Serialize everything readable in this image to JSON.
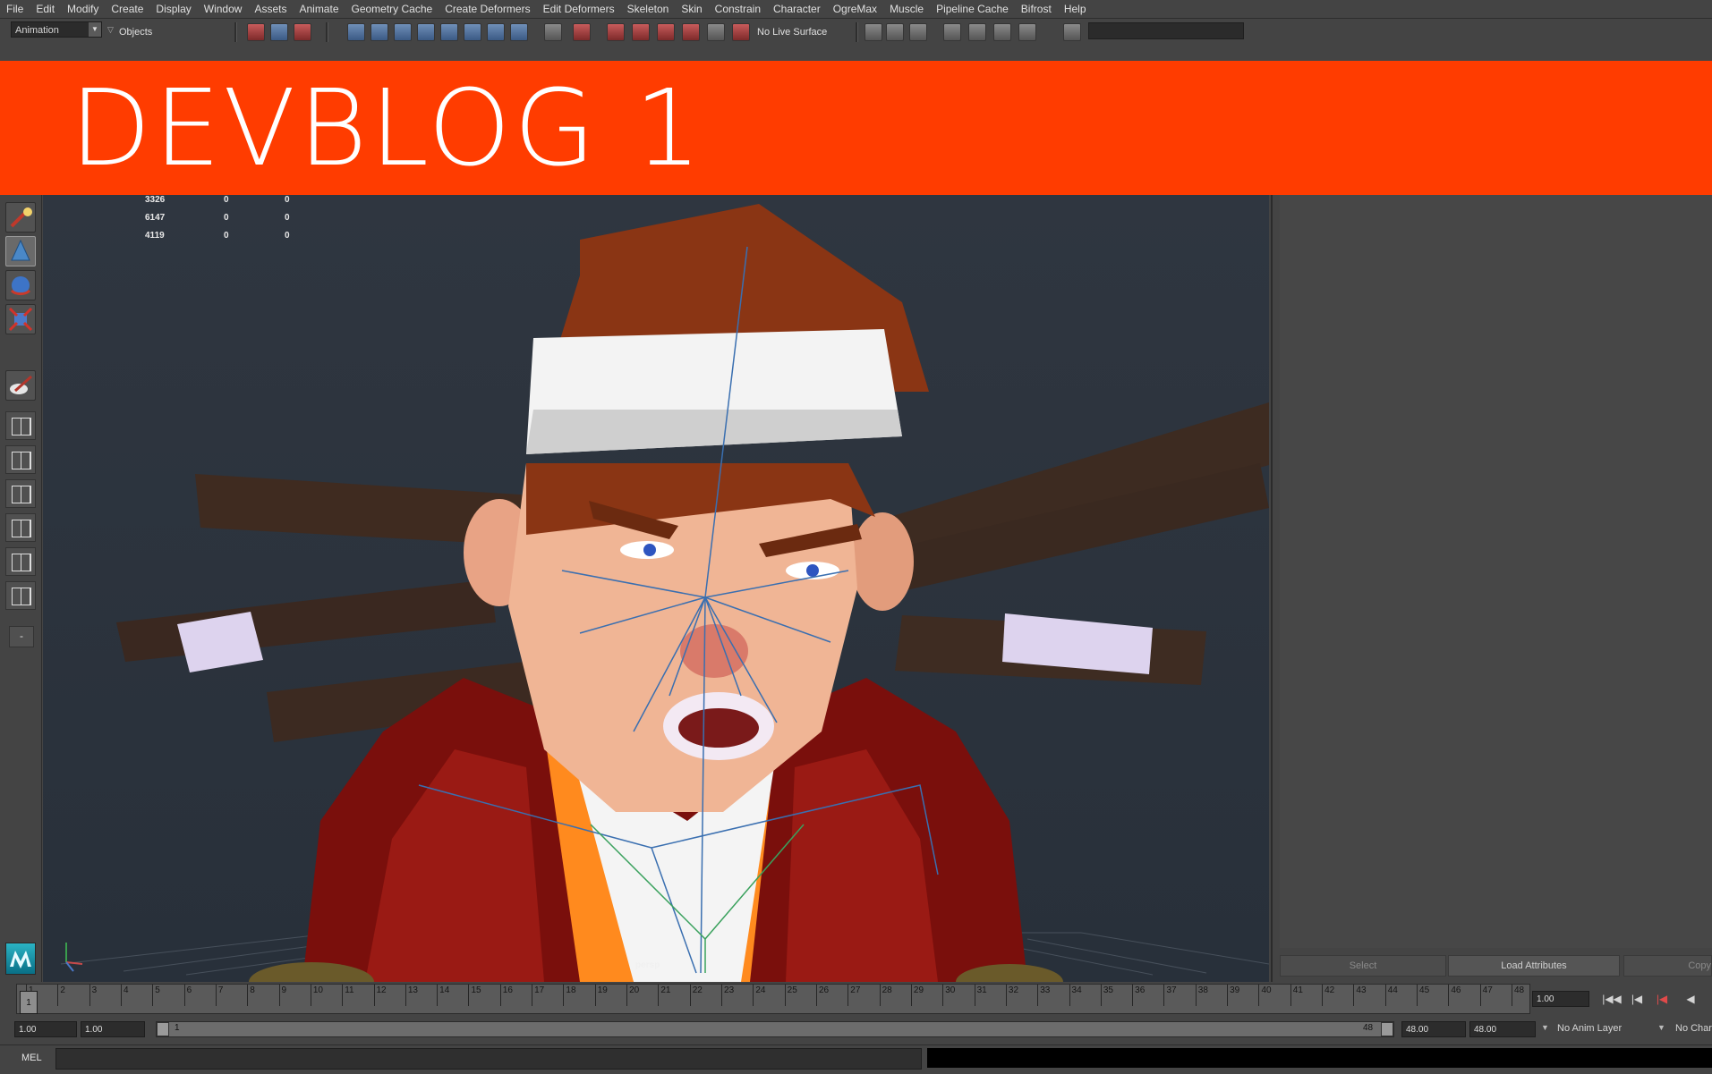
{
  "menu": [
    "File",
    "Edit",
    "Modify",
    "Create",
    "Display",
    "Window",
    "Assets",
    "Animate",
    "Geometry Cache",
    "Create Deformers",
    "Edit Deformers",
    "Skeleton",
    "Skin",
    "Constrain",
    "Character",
    "OgreMax",
    "Muscle",
    "Pipeline Cache",
    "Bifrost",
    "Help"
  ],
  "status_line": {
    "mode": "Animation",
    "selection_mask": "Objects",
    "live_surface": "No Live Surface"
  },
  "banner": {
    "title": "DEVBLOG 1",
    "color": "#ff3c00"
  },
  "viewport": {
    "camera": "persp",
    "stats": [
      {
        "c1": "3326",
        "c2": "0",
        "c3": "0"
      },
      {
        "c1": "6147",
        "c2": "0",
        "c3": "0"
      },
      {
        "c1": "4119",
        "c2": "0",
        "c3": "0"
      }
    ]
  },
  "attribute_editor": {
    "buttons": [
      "Select",
      "Load Attributes",
      "Copy"
    ]
  },
  "time_slider": {
    "current_frame": "1",
    "ticks": [
      "1",
      "2",
      "3",
      "4",
      "5",
      "6",
      "7",
      "8",
      "9",
      "10",
      "11",
      "12",
      "13",
      "14",
      "15",
      "16",
      "17",
      "18",
      "19",
      "20",
      "21",
      "22",
      "23",
      "24",
      "25",
      "26",
      "27",
      "28",
      "29",
      "30",
      "31",
      "32",
      "33",
      "34",
      "35",
      "36",
      "37",
      "38",
      "39",
      "40",
      "41",
      "42",
      "43",
      "44",
      "45",
      "46",
      "47",
      "48"
    ],
    "current_time": "1.00"
  },
  "range_slider": {
    "anim_start": "1.00",
    "range_start": "1.00",
    "range_start_handle": "1",
    "range_end_handle": "48",
    "range_end": "48.00",
    "anim_end": "48.00",
    "anim_layer": "No Anim Layer",
    "character": "No Character Set"
  },
  "command_line": {
    "label": "MEL"
  }
}
